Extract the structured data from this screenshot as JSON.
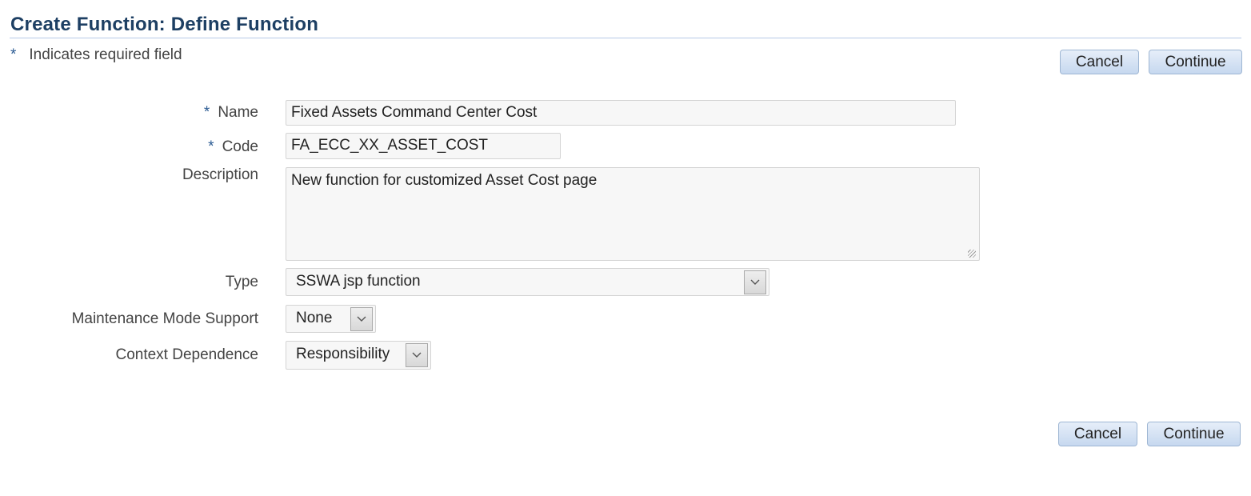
{
  "page": {
    "title": "Create Function: Define Function",
    "required_star": "*",
    "required_note": "Indicates required field"
  },
  "buttons": {
    "cancel": "Cancel",
    "continue": "Continue"
  },
  "form": {
    "name": {
      "label": "Name",
      "required": true,
      "value": "Fixed Assets Command Center Cost"
    },
    "code": {
      "label": "Code",
      "required": true,
      "value": "FA_ECC_XX_ASSET_COST"
    },
    "description": {
      "label": "Description",
      "value": "New function for customized Asset Cost page"
    },
    "type": {
      "label": "Type",
      "selected": "SSWA jsp function"
    },
    "maintenance_mode_support": {
      "label": "Maintenance Mode Support",
      "selected": "None"
    },
    "context_dependence": {
      "label": "Context Dependence",
      "selected": "Responsibility"
    }
  },
  "icons": {
    "dropdown": "chevron-down-icon",
    "resize": "resize-grip-icon"
  },
  "colors": {
    "title": "#1d3f63",
    "accent": "#2a5a92",
    "button_bg": "#c6d8ef"
  }
}
